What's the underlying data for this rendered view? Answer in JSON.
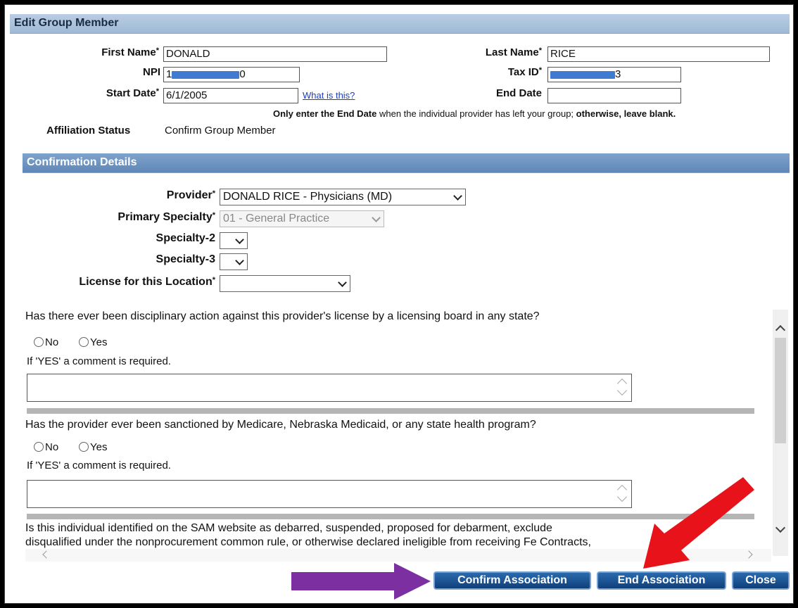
{
  "section_edit": {
    "title": "Edit Group Member"
  },
  "fields": {
    "first_name_label": "First Name",
    "first_name_value": "DONALD",
    "last_name_label": "Last Name",
    "last_name_value": "RICE",
    "npi_label": "NPI",
    "npi_prefix": "1",
    "npi_suffix": "0",
    "tax_id_label": "Tax ID",
    "tax_id_suffix": "3",
    "start_date_label": "Start Date",
    "start_date_value": "6/1/2005",
    "what_is_this_link": "What is this?",
    "end_date_label": "End Date",
    "end_date_value": "",
    "required_mark": "*",
    "end_date_note_bold1": "Only enter the End Date",
    "end_date_note_mid": " when the individual provider has left your group; ",
    "end_date_note_bold2": "otherwise, leave blank.",
    "affiliation_status_label": "Affiliation Status",
    "affiliation_status_value": "Confirm Group Member"
  },
  "section_confirmation": {
    "title": "Confirmation Details"
  },
  "confirmation": {
    "provider_label": "Provider",
    "provider_value": "DONALD RICE - Physicians (MD)",
    "primary_specialty_label": "Primary Specialty",
    "primary_specialty_value": "01 - General Practice",
    "specialty2_label": "Specialty-2",
    "specialty3_label": "Specialty-3",
    "license_label": "License for this Location",
    "license_value": ""
  },
  "questions": [
    {
      "text": "Has there ever been disciplinary action against this provider's license by a licensing board in any state?",
      "no_label": "No",
      "yes_label": "Yes",
      "comment_note": "If 'YES' a comment is required."
    },
    {
      "text": "Has the provider ever been sanctioned by Medicare, Nebraska Medicaid, or any state health program?",
      "no_label": "No",
      "yes_label": "Yes",
      "comment_note": "If 'YES' a comment is required."
    }
  ],
  "question3_line1": "Is this individual identified on the SAM website as debarred, suspended, proposed for debarment, exclude",
  "question3_line2": "disqualified under the nonprocurement common rule, or otherwise declared ineligible from receiving Fe",
  "question3_line2_end": " Contracts,",
  "buttons": {
    "confirm": "Confirm Association",
    "end": "End Association",
    "close": "Close"
  },
  "colors": {
    "purple_arrow": "#7b2fa0",
    "red_arrow": "#e8131a",
    "button_bg": "#124a8a",
    "header_bg": "#a8c0dc"
  }
}
